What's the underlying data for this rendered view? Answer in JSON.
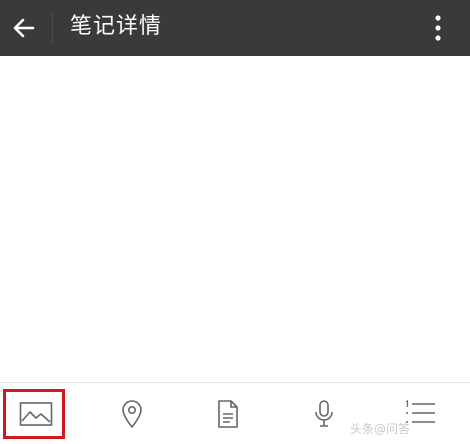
{
  "header": {
    "title": "笔记详情",
    "back_icon": "arrow-left-icon",
    "more_icon": "more-vertical-icon",
    "background_color": "#3a3a3a"
  },
  "toolbar": {
    "items": [
      {
        "icon": "image-icon",
        "highlighted": true
      },
      {
        "icon": "location-pin-icon"
      },
      {
        "icon": "document-icon"
      },
      {
        "icon": "microphone-icon"
      },
      {
        "icon": "numbered-list-icon"
      }
    ],
    "highlight_color": "#d0181f"
  },
  "watermark": {
    "text": "头条@问答"
  }
}
